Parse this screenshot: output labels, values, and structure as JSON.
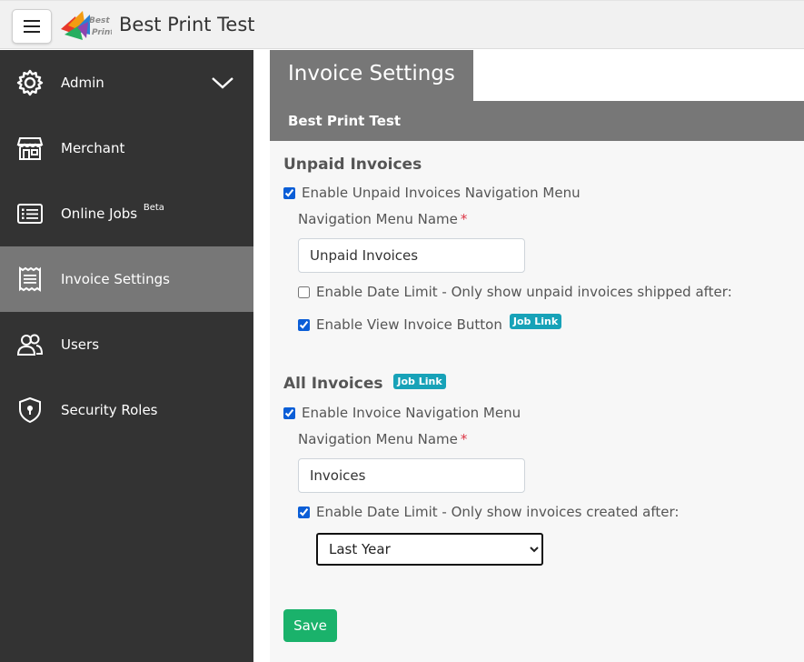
{
  "app": {
    "title": "Best Print Test",
    "logo_text": "Best Print"
  },
  "sidebar": {
    "items": [
      {
        "label": "Admin",
        "icon": "gear-icon"
      },
      {
        "label": "Merchant",
        "icon": "store-icon"
      },
      {
        "label": "Online Jobs",
        "sup": "Beta",
        "icon": "list-icon"
      },
      {
        "label": "Invoice Settings",
        "icon": "invoice-icon",
        "active": true
      },
      {
        "label": "Users",
        "icon": "users-icon"
      },
      {
        "label": "Security Roles",
        "icon": "shield-icon"
      }
    ]
  },
  "page": {
    "title": "Invoice Settings",
    "subheader": "Best Print Test"
  },
  "unpaid": {
    "title": "Unpaid Invoices",
    "enable_label": "Enable Unpaid Invoices Navigation Menu",
    "enable_checked": true,
    "menu_name_label": "Navigation Menu Name",
    "required_mark": "*",
    "menu_name_value": "Unpaid Invoices",
    "date_limit_label": "Enable Date Limit - Only show unpaid invoices shipped after:",
    "date_limit_checked": false,
    "view_button_label": "Enable View Invoice Button",
    "view_button_checked": true,
    "view_button_badge": "Job Link"
  },
  "all": {
    "title": "All Invoices",
    "title_badge": "Job Link",
    "enable_label": "Enable Invoice Navigation Menu",
    "enable_checked": true,
    "menu_name_label": "Navigation Menu Name",
    "required_mark": "*",
    "menu_name_value": "Invoices",
    "date_limit_label": "Enable Date Limit - Only show invoices created after:",
    "date_limit_checked": true,
    "date_limit_selected": "Last Year"
  },
  "actions": {
    "save_label": "Save"
  },
  "colors": {
    "sidebar_bg": "#333333",
    "active_bg": "#777777",
    "badge": "#17a2b8",
    "save": "#1ab26b",
    "required": "#dc3545"
  }
}
